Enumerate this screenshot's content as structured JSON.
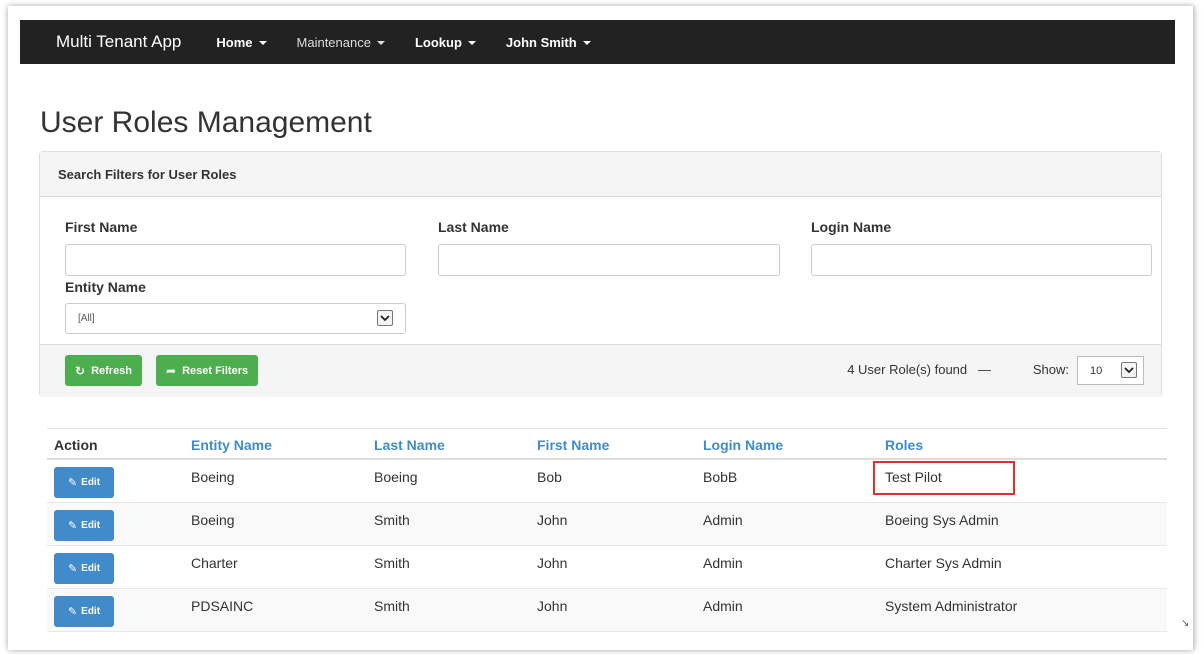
{
  "navbar": {
    "brand": "Multi Tenant App",
    "items": [
      "Home",
      "Maintenance",
      "Lookup",
      "John Smith"
    ]
  },
  "page_title": "User Roles Management",
  "filters": {
    "heading": "Search Filters for User Roles",
    "first_name": {
      "label": "First Name",
      "value": ""
    },
    "last_name": {
      "label": "Last Name",
      "value": ""
    },
    "login_name": {
      "label": "Login Name",
      "value": ""
    },
    "entity_name": {
      "label": "Entity Name",
      "selected": "[All]"
    },
    "refresh_label": "Refresh",
    "reset_label": "Reset Filters",
    "found_text": "4 User Role(s) found",
    "dash": "—",
    "show_label": "Show:",
    "show_value": "10"
  },
  "table": {
    "headers": [
      "Action",
      "Entity Name",
      "Last Name",
      "First Name",
      "Login Name",
      "Roles"
    ],
    "edit_label": "Edit",
    "rows": [
      {
        "entity": "Boeing",
        "last": "Boeing",
        "first": "Bob",
        "login": "BobB",
        "role": "Test Pilot"
      },
      {
        "entity": "Boeing",
        "last": "Smith",
        "first": "John",
        "login": "Admin",
        "role": "Boeing Sys Admin"
      },
      {
        "entity": "Charter",
        "last": "Smith",
        "first": "John",
        "login": "Admin",
        "role": "Charter Sys Admin"
      },
      {
        "entity": "PDSAINC",
        "last": "Smith",
        "first": "John",
        "login": "Admin",
        "role": "System Administrator"
      }
    ]
  },
  "colors": {
    "navbar": "#222222",
    "link_blue": "#428bca",
    "success_green": "#4cae4c",
    "highlight_red": "#e03030"
  }
}
